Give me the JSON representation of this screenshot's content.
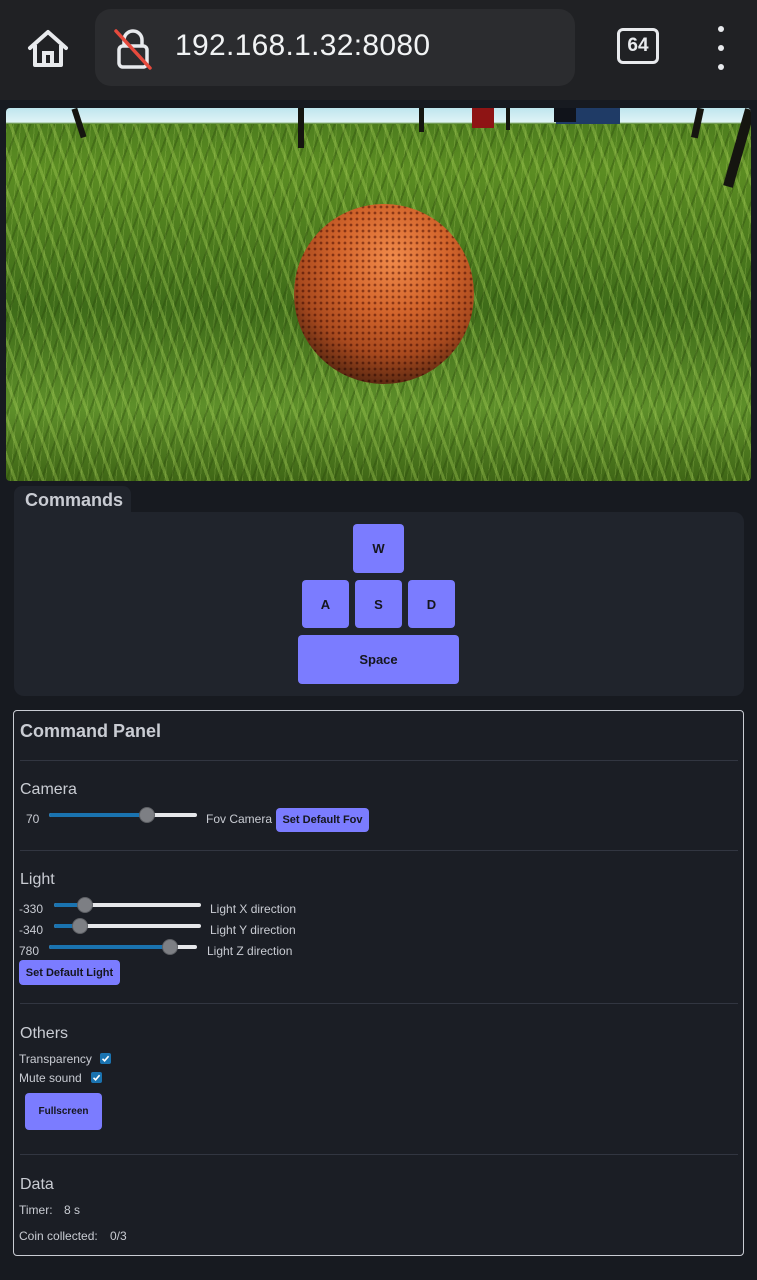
{
  "browser": {
    "url": "192.168.1.32:8080",
    "tab_count": "64",
    "icons": [
      "home-icon",
      "not-secure-lock-icon",
      "tabs-icon",
      "more-menu-icon"
    ]
  },
  "game_view": {
    "description_icons": [
      "ball-icon"
    ]
  },
  "commands": {
    "title": "Commands",
    "keys": {
      "w": "W",
      "a": "A",
      "s": "S",
      "d": "D",
      "space": "Space"
    }
  },
  "panel": {
    "title": "Command Panel",
    "camera": {
      "title": "Camera",
      "fov_value": "70",
      "fov_label": "Fov Camera",
      "fov_level": 0.66,
      "default_button": "Set Default Fov"
    },
    "light": {
      "title": "Light",
      "x_value": "-330",
      "x_label": "Light X direction",
      "x_level": 0.21,
      "y_value": "-340",
      "y_label": "Light Y direction",
      "y_level": 0.18,
      "z_value": "780",
      "z_label": "Light Z direction",
      "z_level": 0.82,
      "default_button": "Set Default Light"
    },
    "others": {
      "title": "Others",
      "transparency_label": "Transparency",
      "transparency_checked": true,
      "mute_label": "Mute sound",
      "mute_checked": true,
      "fullscreen_button": "Fullscreen"
    },
    "data": {
      "title": "Data",
      "timer_label": "Timer:",
      "timer_value": "8 s",
      "coin_label": "Coin collected:",
      "coin_value": "0/3"
    }
  },
  "colors": {
    "accent": "#7b7cff",
    "slider_fill": "#1a73b0",
    "background": "#171a20"
  }
}
